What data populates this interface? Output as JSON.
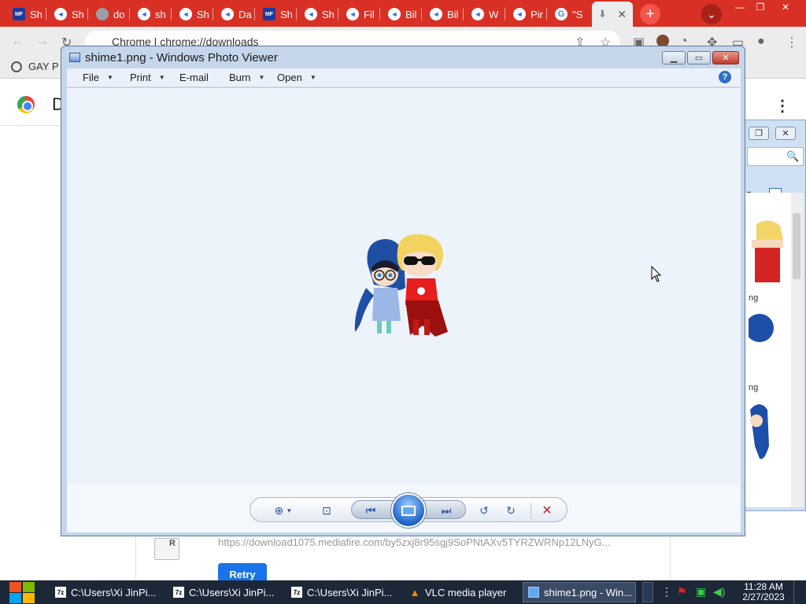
{
  "browser": {
    "tabs": [
      {
        "label": "Sh",
        "icon": "mft-icon"
      },
      {
        "label": "Sh",
        "icon": "telegram-icon"
      },
      {
        "label": "do",
        "icon": "globe-icon"
      },
      {
        "label": "sh",
        "icon": "telegram-icon"
      },
      {
        "label": "Sh",
        "icon": "telegram-icon"
      },
      {
        "label": "Da",
        "icon": "telegram-icon"
      },
      {
        "label": "Sh",
        "icon": "mft-icon"
      },
      {
        "label": "Sh",
        "icon": "telegram-icon"
      },
      {
        "label": "Fil",
        "icon": "telegram-icon"
      },
      {
        "label": "Bil",
        "icon": "telegram-icon"
      },
      {
        "label": "Bil",
        "icon": "telegram-icon"
      },
      {
        "label": "W",
        "icon": "telegram-icon"
      },
      {
        "label": "Pir",
        "icon": "telegram-icon"
      },
      {
        "label": "\"S",
        "icon": "google-icon"
      }
    ],
    "active_tab_icon": "download-icon",
    "active_tab_close": "✕",
    "new_tab": "+",
    "tab_menu": "⌄",
    "window_min": "—",
    "window_max": "❐",
    "window_close": "✕",
    "address": "Chrome  |  chrome://downloads",
    "bookmark": "GAY P",
    "colors": {
      "tabstrip": "#d93025",
      "toolbar": "#ececec"
    }
  },
  "downloads": {
    "title_char": "D",
    "file_badge": "R",
    "url": "https://download1075.mediafire.com/by5zxj8r95sgj9SoPNtAXv5TYRZWRNp12LNyG...",
    "retry": "Retry"
  },
  "explorer_bg": {
    "thumb1_label": "ng",
    "thumb2_label": "ng"
  },
  "photo_viewer": {
    "title": "shime1.png - Windows Photo Viewer",
    "menu": [
      {
        "label": "File",
        "has_caret": true
      },
      {
        "label": "Print",
        "has_caret": true
      },
      {
        "label": "E-mail",
        "has_caret": false
      },
      {
        "label": "Burn",
        "has_caret": true
      },
      {
        "label": "Open",
        "has_caret": true
      }
    ],
    "help": "?",
    "controls": {
      "zoom": "zoom-icon",
      "fit": "actual-size-icon",
      "previous": "previous-icon",
      "slideshow": "slideshow-icon",
      "next": "next-icon",
      "rotate_ccw": "rotate-counterclockwise-icon",
      "rotate_cw": "rotate-clockwise-icon",
      "delete": "delete-icon"
    }
  },
  "taskbar": {
    "items": [
      {
        "label": "C:\\Users\\Xi JinPi...",
        "icon": "7zip-icon"
      },
      {
        "label": "C:\\Users\\Xi JinPi...",
        "icon": "7zip-icon"
      },
      {
        "label": "C:\\Users\\Xi JinPi...",
        "icon": "7zip-icon"
      },
      {
        "label": "VLC media player",
        "icon": "vlc-icon"
      },
      {
        "label": "shime1.png - Win...",
        "icon": "photo-viewer-icon"
      }
    ],
    "time": "11:28 AM",
    "date": "2/27/2023"
  }
}
